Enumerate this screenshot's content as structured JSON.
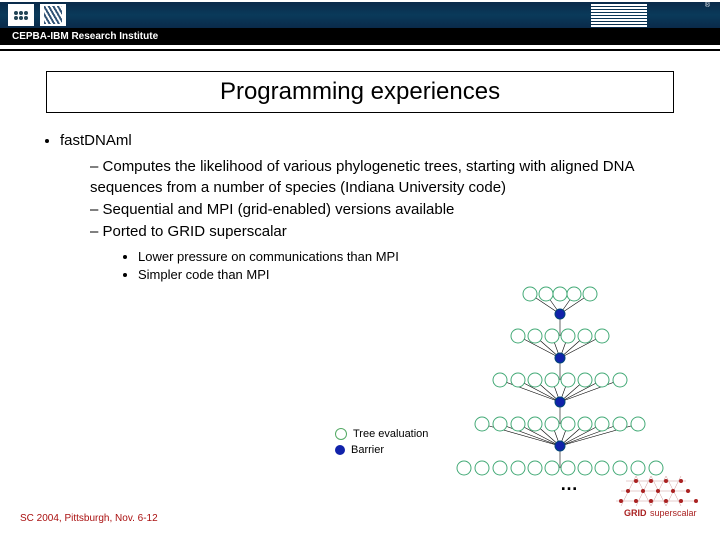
{
  "header": {
    "institute": "CEPBA-IBM Research Institute",
    "ibm_r": "®"
  },
  "title": "Programming experiences",
  "content": {
    "l1": "fastDNAml",
    "sub1": "Computes the likelihood of various phylogenetic trees, starting with aligned DNA sequences from a number of species (Indiana University code)",
    "sub2": "Sequential and MPI (grid-enabled) versions available",
    "sub3": "Ported to GRID superscalar",
    "subsub1": "Lower pressure on communications than MPI",
    "subsub2": "Simpler code than MPI"
  },
  "legend": {
    "tree": "Tree evaluation",
    "barrier": "Barrier"
  },
  "ellipsis": "…",
  "footer": "SC 2004, Pittsburgh, Nov. 6-12",
  "grid_logo_top": "GRID",
  "grid_logo_bottom": "superscalar"
}
